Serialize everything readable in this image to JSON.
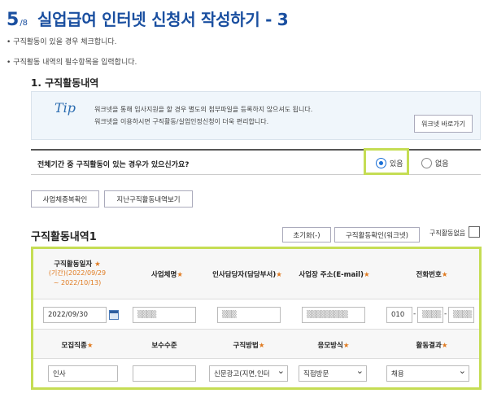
{
  "title": {
    "step": "5",
    "total": "/8",
    "text": "실업급여 인터넷 신청서 작성하기 - 3"
  },
  "bullets": [
    "• 구직활동이 있을 경우 체크합니다.",
    "• 구직활동 내역의 필수항목을 입력합니다."
  ],
  "section1": {
    "heading": "1. 구직활동내역"
  },
  "tip": {
    "label": "Tip",
    "line1": "워크넷을 통해 입사지원을 할 경우 별도의 첨부파일을 등록하지 않으셔도 됩니다.",
    "line2": "워크넷을 이용하시면 구직활동/실업인정신청이 더욱 편리합니다.",
    "button": "워크넷 바로가기"
  },
  "question": {
    "text": "전체기간 중 구직활동이 있는 경우가 있으신가요?",
    "yes": "있음",
    "no": "없음",
    "selected": "yes"
  },
  "actions": {
    "business_check": "사업체종복확인",
    "past_history": "지난구직활동내역보기"
  },
  "activity": {
    "heading": "구직활동내역1",
    "reset": "초기화(-)",
    "worknet_check": "구직활동확인(워크넷)",
    "none_label": "구직활동없음",
    "headers1": {
      "date": "구직활동일자",
      "date_note1": "(기간)(2022/09/29",
      "date_note2": "~ 2022/10/13)",
      "company": "사업체명",
      "hr": "인사담당자(담당부서)",
      "email": "사업장 주소(E-mail)",
      "phone": "전화번호"
    },
    "row1": {
      "date": "2022/09/30",
      "company": "▒▒▒▒",
      "hr": "▒▒▒",
      "email": "▒▒▒▒▒▒▒▒▒",
      "phone1": "010",
      "phone2": "▒▒▒▒",
      "phone3": "▒▒▒▒"
    },
    "headers2": {
      "job": "모집직종",
      "salary": "보수수준",
      "method": "구직방법",
      "apply": "응모방식",
      "result": "활동결과"
    },
    "row2": {
      "job": "인사",
      "salary": "",
      "method": "신문광고(지면,인터",
      "apply": "직접방문",
      "result": "채용"
    },
    "required_mark": "★"
  },
  "colors": {
    "title": "#1a4fa0",
    "highlight": "#c5dd54",
    "required": "#e07b22",
    "radio": "#1a6fd6"
  }
}
